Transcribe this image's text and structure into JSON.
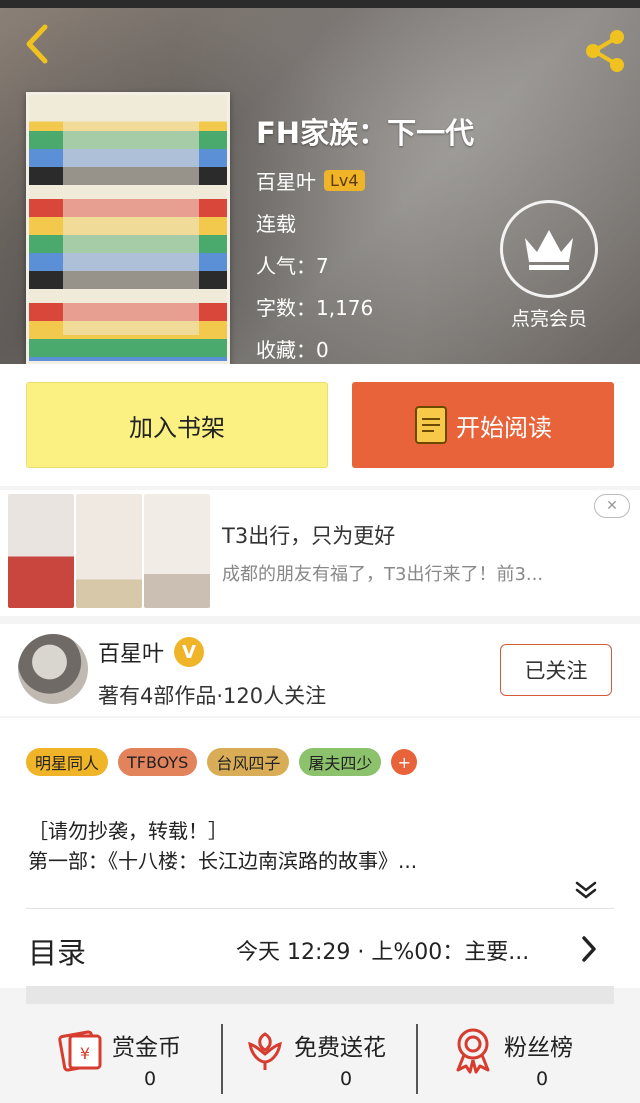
{
  "header": {
    "back_icon": "chevron-left-icon",
    "share_icon": "share-icon"
  },
  "book": {
    "title": "FH家族：下一代",
    "author": "百星叶",
    "level": "Lv4",
    "status": "连载",
    "popularity": "人气：7",
    "word_count": "字数：1,176",
    "favorites": "收藏：0"
  },
  "vip": {
    "icon": "crown-icon",
    "label": "点亮会员"
  },
  "actions": {
    "add_to_shelf": "加入书架",
    "start_reading": "开始阅读",
    "read_icon": "book-icon"
  },
  "ad": {
    "title": "T3出行，只为更好",
    "description": "成都的朋友有福了，T3出行来了！前3...",
    "close_icon": "close-icon"
  },
  "author_card": {
    "name": "百星叶",
    "verified": "V",
    "stats": "著有4部作品·120人关注",
    "follow_label": "已关注"
  },
  "tags": [
    {
      "label": "明星同人",
      "color": "#f0b429"
    },
    {
      "label": "TFBOYS",
      "color": "#e2835c"
    },
    {
      "label": "台风四子",
      "color": "#d9ad55"
    },
    {
      "label": "屠夫四少",
      "color": "#8cc26b"
    }
  ],
  "tag_add_label": "+",
  "description": {
    "line1": "［请勿抄袭，转载！］",
    "line2": "第一部：《十八楼：长江边南滨路的故事》..."
  },
  "toc": {
    "label": "目录",
    "latest": "今天 12:29 · 上%00：主要..."
  },
  "bottom_stats": [
    {
      "label": "赏金币",
      "value": "0",
      "icon": "red-envelope-icon"
    },
    {
      "label": "免费送花",
      "value": "0",
      "icon": "flower-icon"
    },
    {
      "label": "粉丝榜",
      "value": "0",
      "icon": "medal-icon"
    }
  ]
}
